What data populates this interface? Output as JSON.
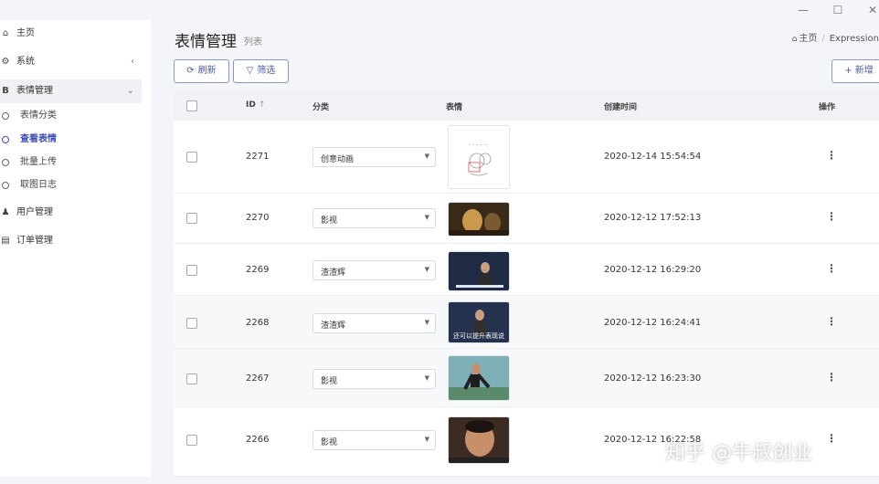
{
  "window": {
    "minimize_icon": "minimize-icon",
    "maximize_icon": "maximize-icon",
    "close_icon": "close-icon"
  },
  "sidebar": {
    "items": [
      {
        "label": "主页",
        "icon": "home-icon"
      },
      {
        "label": "系统",
        "icon": "gear-icon"
      },
      {
        "label": "表情管理",
        "icon": "b-icon"
      }
    ],
    "subitems": [
      {
        "label": "表情分类"
      },
      {
        "label": "查看表情"
      },
      {
        "label": "批量上传"
      },
      {
        "label": "取图日志"
      }
    ],
    "bottom_items": [
      {
        "label": "用户管理",
        "icon": "user-icon"
      },
      {
        "label": "订单管理",
        "icon": "document-icon"
      }
    ],
    "active_color": "#3c4db4"
  },
  "header": {
    "title": "表情管理",
    "subtitle": "列表",
    "breadcrumb": [
      "主页",
      "Expression"
    ]
  },
  "toolbar": {
    "refresh_label": "刷新",
    "filter_label": "筛选",
    "add_label": "+ 新增"
  },
  "table": {
    "columns": [
      "ID",
      "分类",
      "表情",
      "创建时间",
      "操作"
    ],
    "sort_indicator": "↑",
    "rows": [
      {
        "id": "2271",
        "category": "创意动画",
        "created": "2020-12-14 15:54:54"
      },
      {
        "id": "2270",
        "category": "影视",
        "created": "2020-12-12 17:52:13"
      },
      {
        "id": "2269",
        "category": "渣渣辉",
        "created": "2020-12-12 16:29:20"
      },
      {
        "id": "2268",
        "category": "渣渣辉",
        "created": "2020-12-12 16:24:41"
      },
      {
        "id": "2267",
        "category": "影视",
        "created": "2020-12-12 16:23:30"
      },
      {
        "id": "2266",
        "category": "影视",
        "created": "2020-12-12 16:22:58"
      }
    ],
    "thumb_captions": [
      "",
      "",
      "",
      "还可以提升表现说",
      "",
      ""
    ]
  },
  "watermark": "知乎 @牛叔创业"
}
